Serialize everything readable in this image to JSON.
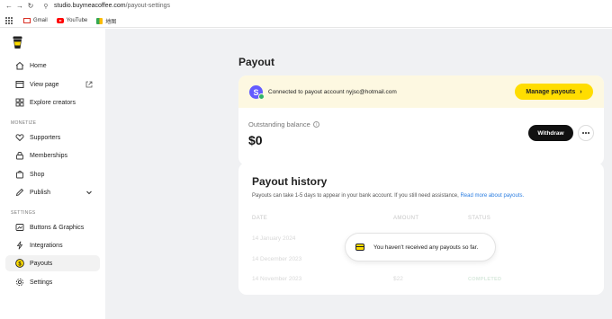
{
  "browser": {
    "url_host": "studio.buymeacoffee.com",
    "url_path": "/payout-settings",
    "bookmarks": [
      {
        "label": "Gmail",
        "icon": "gmail-icon"
      },
      {
        "label": "YouTube",
        "icon": "youtube-icon"
      },
      {
        "label": "地图",
        "icon": "web-icon"
      }
    ]
  },
  "sidebar": {
    "items_top": [
      {
        "label": "Home",
        "icon": "home-icon"
      },
      {
        "label": "View page",
        "icon": "page-icon"
      },
      {
        "label": "Explore creators",
        "icon": "grid-icon"
      }
    ],
    "section_monetize": "MONETIZE",
    "items_monetize": [
      {
        "label": "Supporters",
        "icon": "heart-icon"
      },
      {
        "label": "Memberships",
        "icon": "lock-icon"
      },
      {
        "label": "Shop",
        "icon": "bag-icon"
      },
      {
        "label": "Publish",
        "icon": "pen-icon"
      }
    ],
    "section_settings": "SETTINGS",
    "items_settings": [
      {
        "label": "Buttons & Graphics",
        "icon": "graphics-icon"
      },
      {
        "label": "Integrations",
        "icon": "bolt-icon"
      },
      {
        "label": "Payouts",
        "icon": "dollar-icon",
        "active": true
      },
      {
        "label": "Settings",
        "icon": "gear-icon"
      }
    ]
  },
  "payout": {
    "title": "Payout",
    "stripe_letter": "S",
    "connected_text": "Connected to payout account nyjsc@hotmail.com",
    "manage_label": "Manage payouts",
    "balance_label": "Outstanding balance",
    "balance_amount": "$0",
    "withdraw_label": "Withdraw"
  },
  "history": {
    "title": "Payout history",
    "subtitle": "Payouts can take 1-5 days to appear in your bank account. If you still need assistance, ",
    "link_text": "Read more about payouts.",
    "columns": [
      "DATE",
      "AMOUNT",
      "STATUS"
    ],
    "rows": [
      {
        "date": "14 January 2024",
        "amount": "",
        "status": ""
      },
      {
        "date": "14 December 2023",
        "amount": "",
        "status": ""
      },
      {
        "date": "14 November 2023",
        "amount": "$22",
        "status": "COMPLETED"
      }
    ],
    "toast": "You haven't received any payouts so far."
  },
  "colors": {
    "accent_yellow": "#ffdd00",
    "stripe_purple": "#635bff",
    "link_blue": "#2a7de1"
  }
}
